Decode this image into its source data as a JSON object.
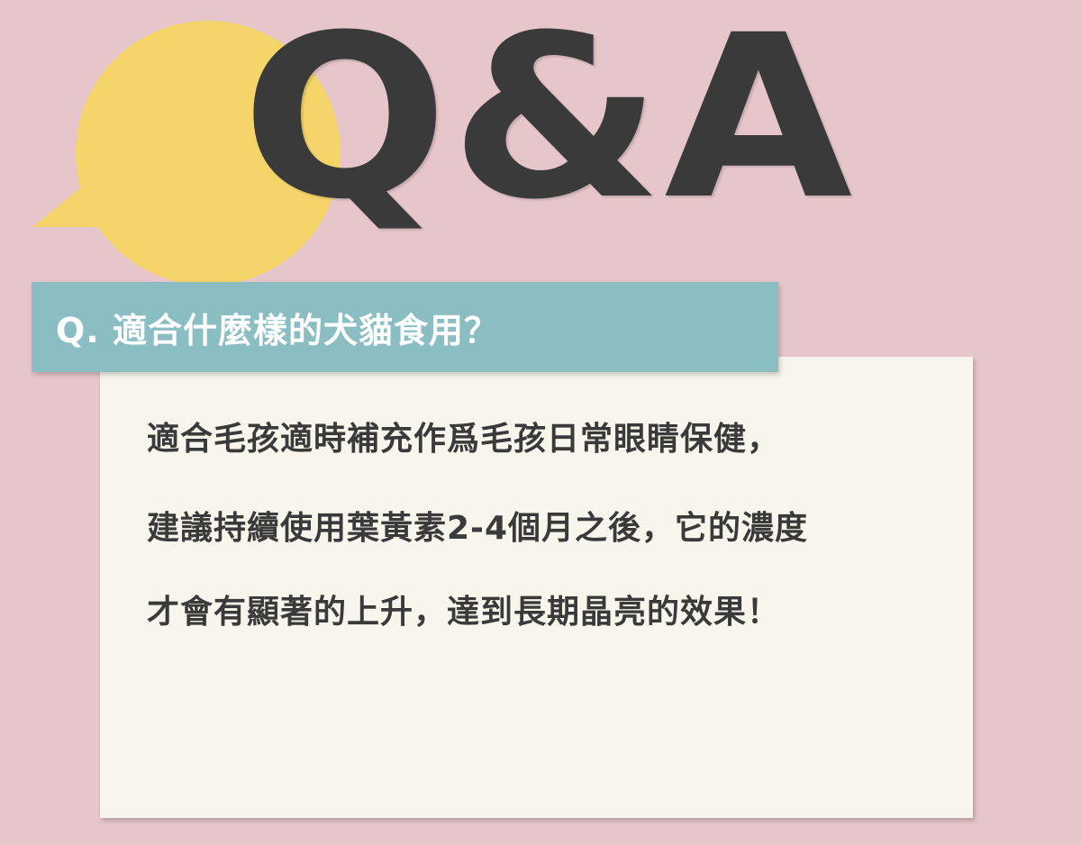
{
  "header": {
    "title": "Q&A"
  },
  "question": {
    "text": "Q. 適合什麼樣的犬貓食用？"
  },
  "answer": {
    "lines": [
      "適合毛孩適時補充作爲毛孩日常眼睛保健，",
      "建議持續使用葉黃素2-4個月之後，它的濃度",
      "才會有顯著的上升，達到長期晶亮的效果！"
    ]
  },
  "colors": {
    "background": "#e6c6ca",
    "bubble": "#f5d46a",
    "heading": "#3a3a3a",
    "banner": "#8bbec3",
    "card": "#f8f6ec",
    "body_text": "#3a3a3a"
  },
  "icons": {
    "bubble": "speech-bubble-icon"
  }
}
